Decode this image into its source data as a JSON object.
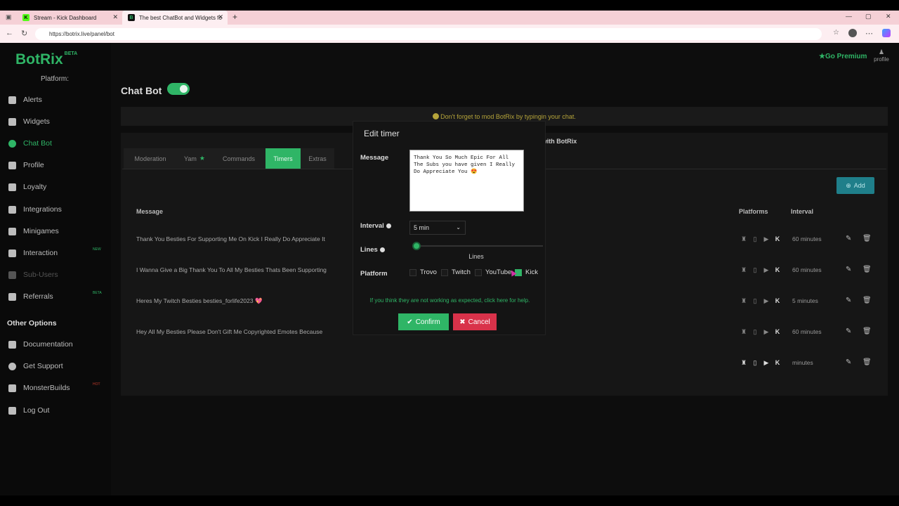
{
  "browser": {
    "tabs": [
      {
        "title": "Stream - Kick Dashboard",
        "favicon": "K"
      },
      {
        "title": "The best ChatBot and Widgets fo",
        "favicon": "B"
      }
    ],
    "url": "https://botrix.live/panel/bot",
    "new_tab": "+"
  },
  "sidebar": {
    "logo": "BotRix",
    "logo_badge": "BETA",
    "platform_label": "Platform:",
    "items": [
      {
        "label": "Alerts"
      },
      {
        "label": "Widgets"
      },
      {
        "label": "Chat Bot"
      },
      {
        "label": "Profile"
      },
      {
        "label": "Loyalty"
      },
      {
        "label": "Integrations"
      },
      {
        "label": "Minigames"
      },
      {
        "label": "Interaction",
        "tag": "NEW"
      },
      {
        "label": "Sub-Users"
      },
      {
        "label": "Referrals",
        "tag": "BETA"
      }
    ],
    "other_options": "Other Options",
    "other_items": [
      {
        "label": "Documentation"
      },
      {
        "label": "Get Support"
      },
      {
        "label": "MonsterBuilds",
        "tag": "HOT"
      },
      {
        "label": "Log Out"
      }
    ]
  },
  "header": {
    "premium": "Go Premium",
    "profile": "profile"
  },
  "main": {
    "title": "Chat Bot",
    "notice": "Don't forget to mod BotRix by typingin your chat.",
    "panel_heading": "Entertain and moderate your stream with BotRix",
    "tabs": [
      {
        "label": "Moderation"
      },
      {
        "label": "Yam"
      },
      {
        "label": "Commands"
      },
      {
        "label": "Timers"
      },
      {
        "label": "Extras"
      }
    ],
    "add_label": "Add",
    "columns": {
      "message": "Message",
      "platforms": "Platforms",
      "interval": "Interval"
    },
    "rows": [
      {
        "message": "Thank You Besties For Supporting Me On Kick I Really Do Appreciate It",
        "interval": "60 minutes"
      },
      {
        "message": "I Wanna Give a Big Thank You To All My Besties Thats Been Supporting",
        "interval": "60 minutes"
      },
      {
        "message": "Heres My Twitch Besties besties_forlife2023 💖",
        "interval": "5 minutes"
      },
      {
        "message": "Hey All My Besties Please Don't Gift Me Copyrighted Emotes Because",
        "interval": "60 minutes"
      },
      {
        "message": "",
        "interval": "minutes"
      }
    ]
  },
  "modal": {
    "title": "Edit timer",
    "message_label": "Message",
    "message_value": "Thank You So Much Epic For All The Subs you have given I Really Do Appreciate You 😍",
    "interval_label": "Interval",
    "interval_value": "5 min",
    "lines_label": "Lines",
    "lines_caption": "Lines",
    "lines_level": 0,
    "platform_label": "Platform",
    "platforms": [
      {
        "label": "Trovo",
        "checked": false
      },
      {
        "label": "Twitch",
        "checked": false
      },
      {
        "label": "YouTube",
        "checked": false
      },
      {
        "label": "Kick",
        "checked": true
      }
    ],
    "help_text": "If you think they are not working as expected, click here for help.",
    "confirm_label": "Confirm",
    "cancel_label": "Cancel"
  },
  "colors": {
    "accent": "#2fb566",
    "danger": "#d9324a",
    "info": "#1f7f8a"
  }
}
